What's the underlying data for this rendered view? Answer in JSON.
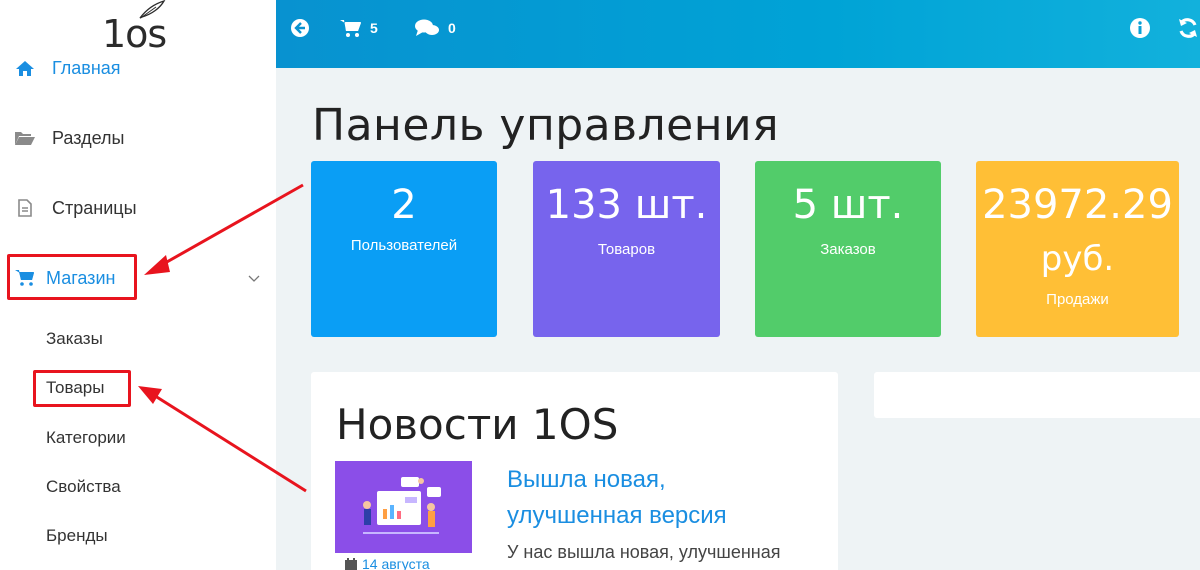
{
  "logo": {
    "text": "1os"
  },
  "sidebar": {
    "items": [
      {
        "label": "Главная",
        "icon": "home-icon"
      },
      {
        "label": "Разделы",
        "icon": "folder-open-icon"
      },
      {
        "label": "Страницы",
        "icon": "file-icon"
      },
      {
        "label": "Магазин",
        "icon": "cart-icon"
      }
    ],
    "shop_subitems": [
      "Заказы",
      "Товары",
      "Категории",
      "Свойства",
      "Бренды"
    ]
  },
  "topbar": {
    "cart_count": "5",
    "comments_count": "0"
  },
  "page": {
    "title": "Панель управления"
  },
  "stats": {
    "users_value": "2",
    "users_label": "Пользователей",
    "goods_value": "133 шт.",
    "goods_label": "Товаров",
    "orders_value": "5 шт.",
    "orders_label": "Заказов",
    "sales_value": "23972.29",
    "sales_unit": "руб.",
    "sales_label": "Продажи"
  },
  "news": {
    "title": "Новости 1OS",
    "item_title": "Вышла новая, улучшенная версия",
    "item_date": "14 августа",
    "item_excerpt": "У нас вышла новая, улучшенная"
  },
  "colors": {
    "topbar": "#0895cf",
    "accent": "#1a8ee1",
    "stat_users": "#0a9ef5",
    "stat_goods": "#7764ed",
    "stat_orders": "#52cc6a",
    "stat_sales": "#ffbf36",
    "annotation": "#e8141e"
  }
}
